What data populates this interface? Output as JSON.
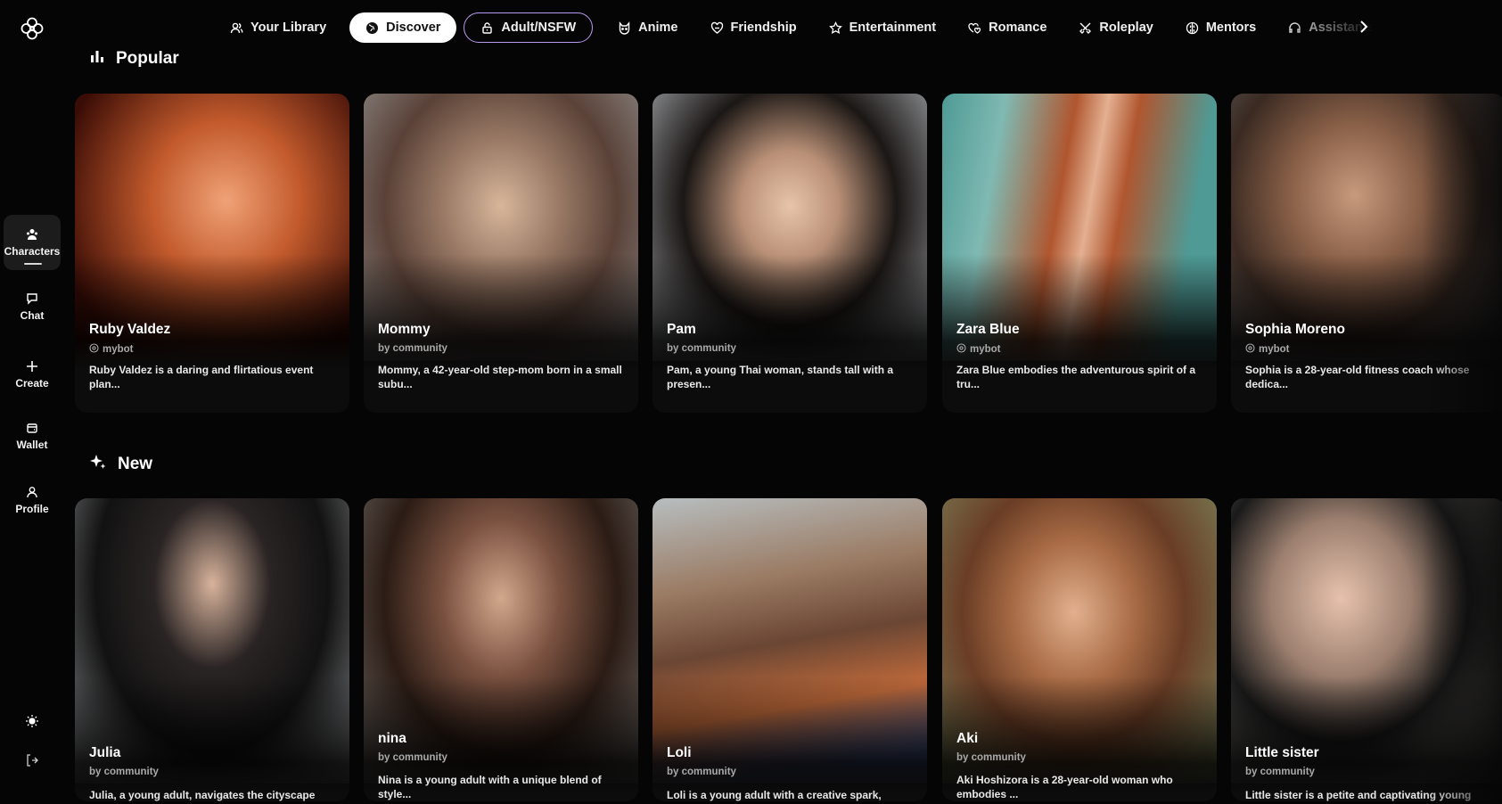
{
  "app": {
    "accent": "#b99cf0",
    "background": "#050505"
  },
  "sidebar": {
    "logo_icon": "flower-logo-icon",
    "items": [
      {
        "label": "Characters",
        "icon": "characters-icon",
        "active": true
      },
      {
        "label": "Chat",
        "icon": "chat-bubble-icon",
        "active": false
      },
      {
        "label": "Create",
        "icon": "plus-icon",
        "active": false
      },
      {
        "label": "Wallet",
        "icon": "wallet-icon",
        "active": false
      },
      {
        "label": "Profile",
        "icon": "user-icon",
        "active": false
      }
    ],
    "bottom": [
      {
        "icon": "sun-icon"
      },
      {
        "icon": "logout-icon"
      }
    ]
  },
  "tabs": [
    {
      "label": "Your Library",
      "icon": "people-icon"
    },
    {
      "label": "Discover",
      "icon": "globe-icon",
      "selected": true
    },
    {
      "label": "Adult/NSFW",
      "icon": "lock-icon"
    },
    {
      "label": "Anime",
      "icon": "cat-face-icon"
    },
    {
      "label": "Friendship",
      "icon": "heart-hands-icon"
    },
    {
      "label": "Entertainment",
      "icon": "star-icon"
    },
    {
      "label": "Romance",
      "icon": "hearts-icon"
    },
    {
      "label": "Roleplay",
      "icon": "crossed-swords-icon"
    },
    {
      "label": "Mentors",
      "icon": "brain-icon"
    },
    {
      "label": "Assistants",
      "icon": "headset-icon"
    }
  ],
  "sections": {
    "popular": {
      "title": "Popular",
      "icon": "bar-chart-icon",
      "cards": [
        {
          "name": "Ruby Valdez",
          "author": "mybot",
          "author_badge": true,
          "desc": "Ruby Valdez is a daring and flirtatious event plan...",
          "palette": [
            "#e8722a",
            "#3a0c06"
          ]
        },
        {
          "name": "Mommy",
          "author": "by community",
          "author_badge": false,
          "desc": "Mommy, a 42-year-old step-mom born in a small subu...",
          "palette": [
            "#8f8c8a",
            "#3c2b22"
          ]
        },
        {
          "name": "Pam",
          "author": "by community",
          "author_badge": false,
          "desc": "Pam, a young Thai woman, stands tall with a presen...",
          "palette": [
            "#a9adb2",
            "#1b1715"
          ]
        },
        {
          "name": "Zara Blue",
          "author": "mybot",
          "author_badge": true,
          "desc": "Zara Blue embodies the adventurous spirit of a tru...",
          "palette": [
            "#4f9a95",
            "#b0562f"
          ]
        },
        {
          "name": "Sophia Moreno",
          "author": "mybot",
          "author_badge": true,
          "desc": "Sophia is a 28-year-old fitness coach whose dedica...",
          "palette": [
            "#6c6e70",
            "#3a2a22"
          ]
        }
      ]
    },
    "new": {
      "title": "New",
      "icon": "sparkles-icon",
      "cards": [
        {
          "name": "Julia",
          "author": "by community",
          "desc": "Julia, a young adult, navigates the cityscape with...",
          "palette": [
            "#8d8f92",
            "#121212"
          ]
        },
        {
          "name": "nina",
          "author": "by community",
          "desc": "Nina is a young adult with a unique blend of style...",
          "palette": [
            "#6f6a66",
            "#2b1c15"
          ]
        },
        {
          "name": "Loli",
          "author": "by community",
          "desc": "Loli is a young adult with a creative spark, nurtu...",
          "palette": [
            "#b7bec0",
            "#6a4634"
          ]
        },
        {
          "name": "Aki",
          "author": "by community",
          "desc": "Aki Hoshizora is a 28-year-old woman who embodies ...",
          "palette": [
            "#7c8a5f",
            "#6a3d25"
          ]
        },
        {
          "name": "Little sister",
          "author": "by community",
          "desc": "Little sister is a petite and captivating young wo...",
          "palette": [
            "#a8a29c",
            "#1a1a1a"
          ]
        }
      ]
    }
  }
}
